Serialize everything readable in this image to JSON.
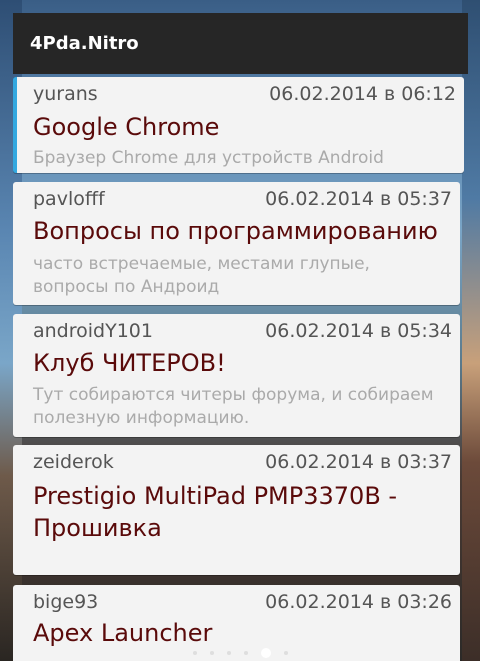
{
  "app": {
    "title": "4Pda.Nitro"
  },
  "topics": [
    {
      "author": "yurans",
      "date": "06.02.2014 в 06:12",
      "title": "Google Chrome",
      "description": "Браузер Chrome для устройств Android"
    },
    {
      "author": "pavlofff",
      "date": "06.02.2014 в 05:37",
      "title": "Вопросы по программированию",
      "description": "часто встречаемые, местами глупые, вопросы по Андроид"
    },
    {
      "author": "androidY101",
      "date": "06.02.2014 в 05:34",
      "title": "Клуб ЧИТЕРОВ!",
      "description": "Тут собираются читеры форума, и собираем полезную информацию."
    },
    {
      "author": "zeiderok",
      "date": "06.02.2014 в 03:37",
      "title": "Prestigio MultiPad PMP3370B - Прошивка",
      "description": ""
    },
    {
      "author": "bige93",
      "date": "06.02.2014 в 03:26",
      "title": "Apex Launcher",
      "description": ""
    }
  ],
  "colors": {
    "accent": "#33a8e0",
    "title_text": "#5a0a0a",
    "titlebar_bg": "#262626",
    "card_bg": "#f3f3f3"
  },
  "page_indicator": {
    "pages": 6,
    "current": 5
  }
}
